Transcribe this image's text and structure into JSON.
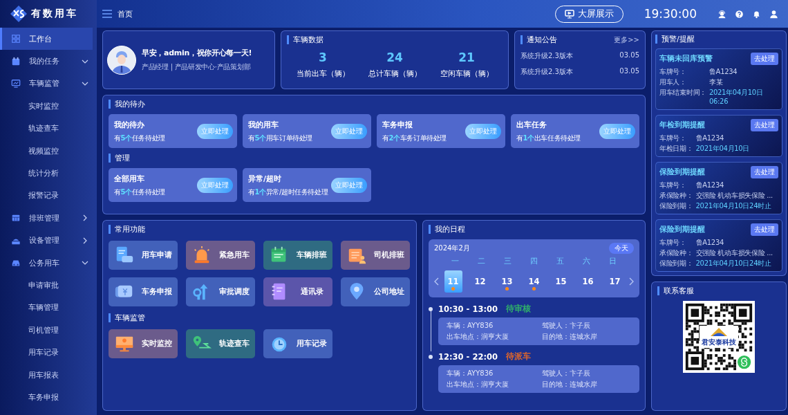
{
  "sidebar": {
    "logo_text": "有数用车",
    "items": [
      {
        "label": "工作台",
        "selected": true
      },
      {
        "label": "我的任务",
        "selected": false,
        "expanded": true
      },
      {
        "label": "车辆监管",
        "selected": false,
        "expanded": true,
        "children": [
          {
            "label": "实时监控",
            "selected": false
          },
          {
            "label": "轨迹查车",
            "selected": false
          },
          {
            "label": "视频监控",
            "selected": false
          },
          {
            "label": "统计分析",
            "selected": false
          },
          {
            "label": "报警记录",
            "selected": false
          }
        ]
      },
      {
        "label": "排班管理",
        "selected": false,
        "expanded": false
      },
      {
        "label": "设备管理",
        "selected": false,
        "expanded": false
      },
      {
        "label": "公务用车",
        "selected": false,
        "expanded": true,
        "children": [
          {
            "label": "申请审批",
            "selected": false
          },
          {
            "label": "车辆管理",
            "selected": false
          },
          {
            "label": "司机管理",
            "selected": false
          },
          {
            "label": "用车记录",
            "selected": false
          },
          {
            "label": "用车报表",
            "selected": false
          },
          {
            "label": "车务申报",
            "selected": false
          }
        ]
      }
    ]
  },
  "header": {
    "page_title": "首页",
    "big_screen_button": "大屏展示",
    "time": "19:30:00"
  },
  "greeting": {
    "text": "早安，admin，祝你开心每一天!",
    "subtitle": "产品经理 | 产品研发中心·产品策划部"
  },
  "vehicle_data": {
    "title": "车辆数据",
    "stats": [
      {
        "value": "3",
        "label": "当前出车（辆）"
      },
      {
        "value": "24",
        "label": "总计车辆（辆）"
      },
      {
        "value": "21",
        "label": "空闲车辆（辆）"
      }
    ]
  },
  "notices": {
    "title": "通知公告",
    "more_link": "更多>>",
    "items": [
      {
        "title": "系统升级2.3版本",
        "date": "03.05"
      },
      {
        "title": "系统升级2.3版本",
        "date": "03.05"
      }
    ]
  },
  "todo": {
    "sections": [
      {
        "title": "我的待办",
        "cards": [
          {
            "title": "我的待办",
            "text": "有**5个**任务待处理",
            "button": "立即处理"
          },
          {
            "title": "我的用车",
            "text": "有**5个**用车订单待处理",
            "button": "立即处理"
          },
          {
            "title": "车务申报",
            "text": "有**2个**车务订单待处理",
            "button": "立即处理"
          },
          {
            "title": "出车任务",
            "text": "有**1个**出车任务待处理",
            "button": "立即处理"
          }
        ]
      },
      {
        "title": "管理",
        "cards": [
          {
            "title": "全部用车",
            "text": "有**5个**任务待处理",
            "button": "立即处理"
          },
          {
            "title": "异常/超时",
            "text": "有**1个**异常/超时任务待处理",
            "button": "立即处理"
          }
        ]
      }
    ]
  },
  "functions": {
    "sections": [
      {
        "title": "常用功能",
        "tiles": [
          {
            "label": "用车申请",
            "color": "#4261ba"
          },
          {
            "label": "紧急用车",
            "color": "#6b5b8c"
          },
          {
            "label": "车辆排班",
            "color": "#2f6b82"
          },
          {
            "label": "司机排班",
            "color": "#6b5b8c"
          },
          {
            "label": "车务申报",
            "color": "#4261ba"
          },
          {
            "label": "审批调度",
            "color": "#4261ba"
          },
          {
            "label": "通讯录",
            "color": "#5b55aa"
          },
          {
            "label": "公司地址",
            "color": "#4261ba"
          }
        ]
      },
      {
        "title": "车辆监管",
        "tiles": [
          {
            "label": "实时监控",
            "color": "#6b5b8c"
          },
          {
            "label": "轨迹查车",
            "color": "#2f6b82"
          },
          {
            "label": "用车记录",
            "color": "#4261ba"
          }
        ]
      }
    ]
  },
  "schedule": {
    "title": "我的日程",
    "month": "2024年2月",
    "today_button": "今天",
    "weekdays": [
      "一",
      "二",
      "三",
      "四",
      "五",
      "六",
      "日"
    ],
    "days": [
      {
        "label": "11",
        "selected": true,
        "has_event": true
      },
      {
        "label": "12",
        "selected": false,
        "has_event": false
      },
      {
        "label": "13",
        "selected": false,
        "has_event": true
      },
      {
        "label": "14",
        "selected": false,
        "has_event": true
      },
      {
        "label": "15",
        "selected": false,
        "has_event": false
      },
      {
        "label": "16",
        "selected": false,
        "has_event": false
      },
      {
        "label": "17",
        "selected": false,
        "has_event": false
      }
    ],
    "events": [
      {
        "time": "10:30 - 13:00",
        "status": "待审核",
        "color": "#2fae6a",
        "fields": [
          {
            "label": "车辆：",
            "value": "AYY836"
          },
          {
            "label": "驾驶人：",
            "value": "卞子辰"
          },
          {
            "label": "出车地点：",
            "value": "润亨大厦"
          },
          {
            "label": "目的地：",
            "value": "连城水岸"
          }
        ]
      },
      {
        "time": "12:30 - 22:00",
        "status": "待派车",
        "color": "#e0662a",
        "fields": [
          {
            "label": "车辆：",
            "value": "AYY836"
          },
          {
            "label": "驾驶人：",
            "value": "卞子辰"
          },
          {
            "label": "出车地点：",
            "value": "润亨大厦"
          },
          {
            "label": "目的地：",
            "value": "连城水岸"
          }
        ]
      }
    ]
  },
  "alerts": {
    "title": "预警/提醒",
    "items": [
      {
        "title": "车辆未回库预警",
        "button": "去处理",
        "fields": [
          {
            "label": "车牌号：",
            "value": "鲁A1234",
            "highlight": false
          },
          {
            "label": "用车人：",
            "value": "李某",
            "highlight": false
          },
          {
            "label": "用车结束时间：",
            "value": "2021年04月10日 06:26",
            "highlight": true
          }
        ]
      },
      {
        "title": "年检到期提醒",
        "button": "去处理",
        "fields": [
          {
            "label": "车牌号：",
            "value": "鲁A1234",
            "highlight": false
          },
          {
            "label": "年检日期：",
            "value": "2021年04月10日",
            "highlight": true
          }
        ]
      },
      {
        "title": "保险到期提醒",
        "button": "去处理",
        "fields": [
          {
            "label": "车牌号：",
            "value": "鲁A1234",
            "highlight": false
          },
          {
            "label": "承保险种：",
            "value": "交强险 机动车损失保险 ...",
            "highlight": false
          },
          {
            "label": "保险到期：",
            "value": "2021年04月10日24时止",
            "highlight": true
          }
        ]
      },
      {
        "title": "保险到期提醒",
        "button": "去处理",
        "fields": [
          {
            "label": "车牌号：",
            "value": "鲁A1234",
            "highlight": false
          },
          {
            "label": "承保险种：",
            "value": "交强险 机动车损失保险 ...",
            "highlight": false
          },
          {
            "label": "保险到期：",
            "value": "2021年04月10日24时止",
            "highlight": true
          }
        ]
      }
    ]
  },
  "contact": {
    "title": "联系客服",
    "qr_logo_text": "君安泰科技"
  }
}
